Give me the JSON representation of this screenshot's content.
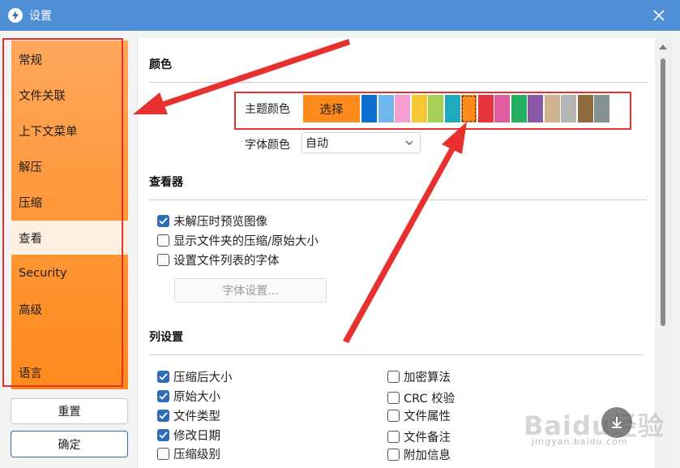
{
  "window": {
    "title": "设置"
  },
  "sidebar": {
    "items": [
      {
        "label": "常规"
      },
      {
        "label": "文件关联"
      },
      {
        "label": "上下文菜单"
      },
      {
        "label": "解压"
      },
      {
        "label": "压缩"
      },
      {
        "label": "查看",
        "active": true
      },
      {
        "label": "Security"
      },
      {
        "label": "高级"
      },
      {
        "label": "语言"
      }
    ],
    "reset_label": "重置",
    "ok_label": "确定"
  },
  "colors": {
    "section_title": "颜色",
    "theme_label": "主题颜色",
    "theme_choose": "选择",
    "font_color_label": "字体颜色",
    "font_color_value": "自动",
    "swatches": [
      "#0a6fd1",
      "#6fb8ee",
      "#f59ecf",
      "#f7c733",
      "#a6cf55",
      "#21a9bf",
      "#ff8a1c",
      "#e8343c",
      "#e25ca2",
      "#25b061",
      "#8a5aa6",
      "#cdb38e",
      "#b5b5b5",
      "#8f6a3f",
      "#869191"
    ],
    "accent": "#ff8a1c",
    "highlight": "#e8302f"
  },
  "viewer": {
    "section_title": "查看器",
    "options": [
      {
        "label": "未解压时预览图像",
        "checked": true
      },
      {
        "label": "显示文件夹的压缩/原始大小",
        "checked": false
      },
      {
        "label": "设置文件列表的字体",
        "checked": false
      }
    ],
    "font_button": "字体设置..."
  },
  "columns": {
    "section_title": "列设置",
    "left": [
      {
        "label": "压缩后大小",
        "checked": true
      },
      {
        "label": "原始大小",
        "checked": true
      },
      {
        "label": "文件类型",
        "checked": true
      },
      {
        "label": "修改日期",
        "checked": true
      },
      {
        "label": "压缩级别",
        "checked": false
      }
    ],
    "right": [
      {
        "label": "加密算法",
        "checked": false
      },
      {
        "label": "CRC 校验",
        "checked": false
      },
      {
        "label": "文件属性",
        "checked": false
      },
      {
        "label": "文件备注",
        "checked": false
      },
      {
        "label": "附加信息",
        "checked": false
      }
    ]
  },
  "watermark": {
    "logo": "Baidu经验",
    "sub": "jingyan.baidu.com"
  }
}
